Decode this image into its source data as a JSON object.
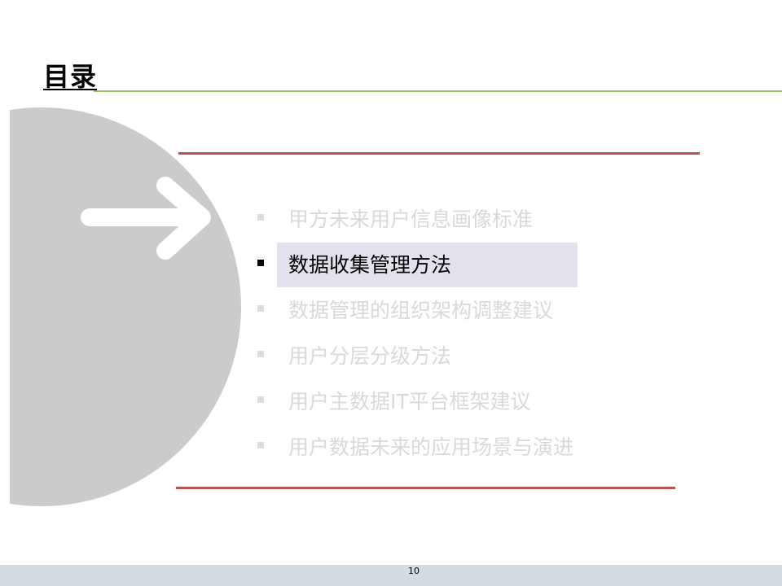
{
  "slide": {
    "title": "目录",
    "page_number": "10"
  },
  "toc": {
    "items": [
      {
        "label": "甲方未来用户信息画像标准",
        "active": false
      },
      {
        "label": "数据收集管理方法",
        "active": true
      },
      {
        "label": "数据管理的组织架构调整建议",
        "active": false
      },
      {
        "label": "用户分层分级方法",
        "active": false
      },
      {
        "label": "用户主数据IT平台框架建议",
        "active": false
      },
      {
        "label": "用户数据未来的应用场景与演进",
        "active": false
      }
    ]
  },
  "colors": {
    "title_rule": "#9bc25a",
    "divider_rule": "#b85450",
    "disc": "#cbcbcb",
    "highlight": "#e4e0ec",
    "inactive_text": "#d9d9d9",
    "footer_bar": "#d5dbe3"
  },
  "icons": {
    "arrow": "arrow-right-icon"
  }
}
